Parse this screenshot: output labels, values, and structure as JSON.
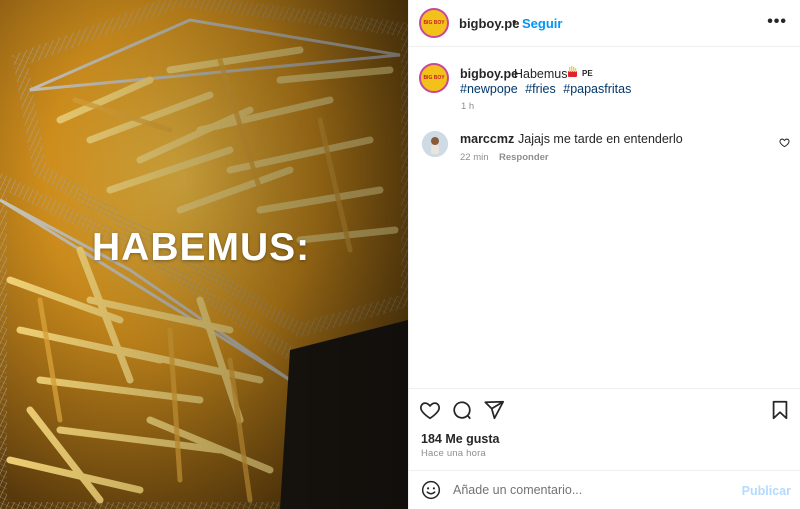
{
  "media": {
    "overlay_text": "HABEMUS:"
  },
  "header": {
    "avatar_logo": "BIG BOY",
    "username": "bigboy.pe",
    "separator": "•",
    "follow_label": "Seguir",
    "more_label": "•••"
  },
  "caption": {
    "username": "bigboy.pe",
    "text": "Habemus",
    "emoji": "french-fries-emoji",
    "country_code": "PE",
    "hashtags": [
      "#newpope",
      "#fries",
      "#papasfritas"
    ],
    "time": "1 h"
  },
  "comment": {
    "username": "marccmz",
    "text": "Jajajs me tarde en entenderlo",
    "time": "22 min",
    "reply_label": "Responder"
  },
  "actions": {
    "likes": "184 Me gusta",
    "posted_ago": "Hace una hora"
  },
  "composer": {
    "placeholder": "Añade un comentario...",
    "publish_label": "Publicar"
  },
  "colors": {
    "link_blue": "#0095f6",
    "hashtag_blue": "#00376b",
    "muted_gray": "#8e8e8e",
    "publish_disabled": "#b3dbff",
    "avatar_yellow": "#f2c21b",
    "avatar_ring": "#c7479a"
  }
}
